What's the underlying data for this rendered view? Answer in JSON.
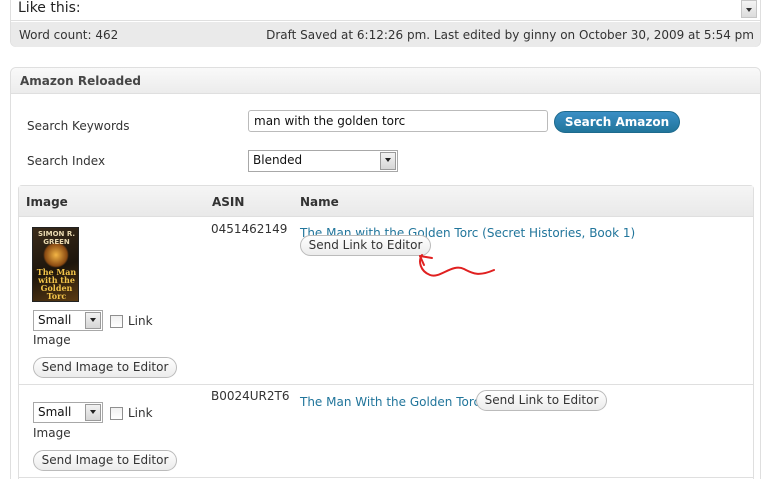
{
  "editor": {
    "text": "Like this:",
    "word_count": "Word count: 462",
    "draft_status": "Draft Saved at 6:12:26 pm. Last edited by ginny on October 30, 2009 at 5:54 pm"
  },
  "panel": {
    "title": "Amazon Reloaded",
    "keywords_label": "Search Keywords",
    "keywords_value": "man with the golden torc",
    "search_button": "Search Amazon",
    "index_label": "Search Index",
    "index_value": "Blended"
  },
  "table": {
    "headers": [
      "Image",
      "ASIN",
      "Name"
    ],
    "rows": [
      {
        "asin": "0451462149",
        "name": "The Man with the Golden Torc (Secret Histories, Book 1)",
        "send_link": "Send Link to Editor",
        "size": "Small",
        "link_label": "Link",
        "image_label": "Image",
        "send_image": "Send Image to Editor",
        "cover_author": "SIMON R. GREEN",
        "cover_title": "The Man with the Golden Torc"
      },
      {
        "asin": "B0024UR2T6",
        "name": "The Man With the Golden Torc",
        "send_link": "Send Link to Editor",
        "size": "Small",
        "link_label": "Link",
        "image_label": "Image",
        "send_image": "Send Image to Editor"
      }
    ]
  },
  "colors": {
    "accent": "#21759b",
    "annotation": "#e02020"
  }
}
